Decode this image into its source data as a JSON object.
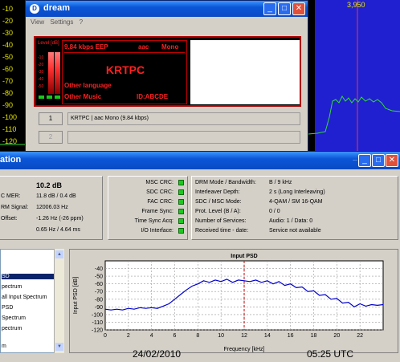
{
  "scope": {
    "y_labels": [
      "-10",
      "-20",
      "-30",
      "-40",
      "-50",
      "-60",
      "-70",
      "-80",
      "-90",
      "-100",
      "-110",
      "-120"
    ],
    "marker_label": "3,950",
    "colors": {
      "background": "#000000",
      "axis_text": "#e6e600",
      "band": "#2020d0",
      "trace": "#33dd33",
      "marker": "#ff3030"
    }
  },
  "dream_window": {
    "title": "dream",
    "menu": [
      "View",
      "Settings",
      "?"
    ],
    "level_label": "Level [dB]",
    "level_ticks": [
      "-10",
      "-20",
      "-30",
      "-40",
      "-50"
    ],
    "lcd": {
      "bitrate": "9.84 kbps EEP",
      "codec": "aac",
      "mode": "Mono",
      "station": "KRTPC",
      "language": "Other language",
      "genre": "Other Music",
      "id": "ID:ABCDE"
    },
    "services": [
      {
        "button": "1",
        "label": "KRTPC  |  aac Mono (9.84 kbps)"
      },
      {
        "button": "2",
        "label": ""
      }
    ]
  },
  "eval_window": {
    "title": "ation",
    "stats": {
      "snr": "10.2 dB",
      "mer_label": "C MER:",
      "mer_value": "11.8 dB / 0.4 dB",
      "drm_signal_label": "RM Signal:",
      "drm_signal_value": "12006.03 Hz",
      "offset_label": "Offset:",
      "offset_value": "-1.26 Hz (-26 ppm)",
      "doppler_value": "0.65 Hz / 4.64 ms"
    },
    "crc": [
      {
        "label": "MSC CRC:",
        "status": "ok"
      },
      {
        "label": "SDC CRC:",
        "status": "ok"
      },
      {
        "label": "FAC CRC:",
        "status": "ok"
      },
      {
        "label": "Frame Sync:",
        "status": "ok"
      },
      {
        "label": "Time Sync Acq:",
        "status": "ok"
      },
      {
        "label": "I/O Interface:",
        "status": "ok"
      }
    ],
    "info": [
      {
        "key": "DRM Mode / Bandwidth:",
        "value": "B / 9 kHz"
      },
      {
        "key": "Interleaver Depth:",
        "value": "2 s (Long Interleaving)"
      },
      {
        "key": "SDC / MSC Mode:",
        "value": "4-QAM / SM 16-QAM"
      },
      {
        "key": "Prot. Level (B / A):",
        "value": "0 / 0"
      },
      {
        "key": "Number of Services:",
        "value": "Audio: 1 / Data: 0"
      },
      {
        "key": "Received time - date:",
        "value": "Service not available"
      }
    ],
    "chart_list": [
      "SD",
      "pectrum",
      "all Input Spectrum",
      "PSD",
      "Spectrum",
      "pectrum",
      "",
      "m"
    ],
    "selected_chart_index": 0
  },
  "footer": {
    "date": "24/02/2010",
    "time": "05:25 UTC"
  },
  "chart_data": {
    "type": "line",
    "title": "Input PSD",
    "xlabel": "Frequency [kHz]",
    "ylabel": "Input PSD [dB]",
    "xlim": [
      0,
      24
    ],
    "ylim": [
      -120,
      -30
    ],
    "x_ticks": [
      0,
      2,
      4,
      6,
      8,
      10,
      12,
      14,
      16,
      18,
      20,
      22
    ],
    "y_ticks": [
      -40,
      -50,
      -60,
      -70,
      -80,
      -90,
      -100,
      -110,
      -120
    ],
    "marker_x": 12,
    "grid": true,
    "series": [
      {
        "x": [
          0,
          0.5,
          1,
          1.5,
          2,
          2.5,
          3,
          3.5,
          4,
          4.5,
          5,
          5.5,
          6,
          6.5,
          7,
          7.5,
          8,
          8.5,
          9,
          9.5,
          10,
          10.5,
          11,
          11.5,
          12,
          12.5,
          13,
          13.5,
          14,
          14.5,
          15,
          15.5,
          16,
          16.5,
          17,
          17.5,
          18,
          18.5,
          19,
          19.5,
          20,
          20.5,
          21,
          21.5,
          22,
          22.5,
          23,
          23.5,
          24
        ],
        "values": [
          -93,
          -94,
          -93,
          -94,
          -92,
          -93,
          -91,
          -92,
          -91,
          -92,
          -89,
          -86,
          -80,
          -74,
          -68,
          -63,
          -60,
          -56,
          -58,
          -55,
          -57,
          -54,
          -58,
          -55,
          -56,
          -57,
          -55,
          -58,
          -56,
          -60,
          -57,
          -62,
          -60,
          -65,
          -64,
          -70,
          -69,
          -75,
          -74,
          -80,
          -79,
          -85,
          -84,
          -90,
          -86,
          -89,
          -87,
          -88,
          -87
        ]
      }
    ],
    "colors": {
      "line": "#0000cc",
      "marker": "#cc0000",
      "plot_bg": "#ffffff"
    }
  }
}
